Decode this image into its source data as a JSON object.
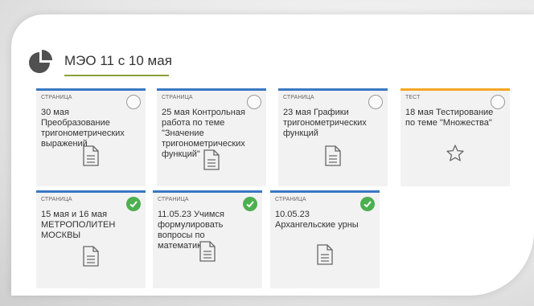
{
  "header": {
    "title": "МЭО 11 с 10 мая",
    "icon": "pie-chart-icon",
    "accent": "#8aa23a"
  },
  "colors": {
    "page_border": "#3a78c2",
    "test_border": "#f5a623",
    "check": "#4caf50"
  },
  "cards": [
    {
      "type": "СТРАНИЦА",
      "text": "30 мая Преобразование тригонометрических выражений",
      "status": "incomplete",
      "icon": "document-icon"
    },
    {
      "type": "СТРАНИЦА",
      "text": "25 мая Контрольная работа по теме \"Значение тригонометрических функций\"",
      "status": "incomplete",
      "icon": "document-icon"
    },
    {
      "type": "СТРАНИЦА",
      "text": "23 мая Графики тригонометрических функций",
      "status": "incomplete",
      "icon": "document-icon"
    },
    {
      "type": "ТЕСТ",
      "text": "18 мая Тестирование по теме \"Множества\"",
      "status": "incomplete",
      "icon": "star-icon"
    },
    {
      "type": "СТРАНИЦА",
      "text": "15 мая и 16 мая МЕТРОПОЛИТЕН МОСКВЫ",
      "status": "complete",
      "icon": "document-icon"
    },
    {
      "type": "СТРАНИЦА",
      "text": "11.05.23 Учимся формулировать вопросы по математике",
      "status": "complete",
      "icon": "document-icon"
    },
    {
      "type": "СТРАНИЦА",
      "text": "10.05.23 Архангельские урны",
      "status": "complete",
      "icon": "document-icon"
    }
  ]
}
